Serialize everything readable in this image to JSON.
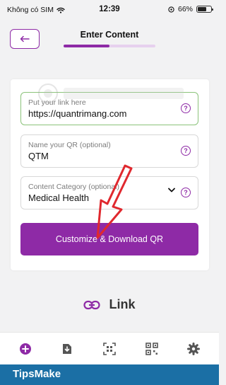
{
  "status_bar": {
    "carrier": "Không có SIM",
    "time": "12:39",
    "battery_pct": "66%",
    "battery_level": 0.66
  },
  "header": {
    "title": "Enter Content",
    "progress": 0.5
  },
  "form": {
    "link_label": "Put your link here",
    "link_value": "https://quantrimang.com",
    "name_label": "Name your QR (optional)",
    "name_value": "QTM",
    "category_label": "Content Category (optional)",
    "category_value": "Medical Health",
    "help_glyph": "?",
    "submit_label": "Customize & Download QR"
  },
  "link_section": {
    "title": "Link",
    "icon": "link-icon"
  },
  "tab_bar": {
    "icons": [
      "plus-circle-icon",
      "download-doc-icon",
      "qr-scan-icon",
      "qr-grid-icon",
      "gear-icon"
    ]
  },
  "brand": {
    "name": "TipsMake"
  },
  "colors": {
    "accent": "#8e2aa6",
    "active_field_border": "#8bc37a",
    "brand_bar": "#1b6fa5",
    "annotation_arrow": "#e0282e"
  }
}
